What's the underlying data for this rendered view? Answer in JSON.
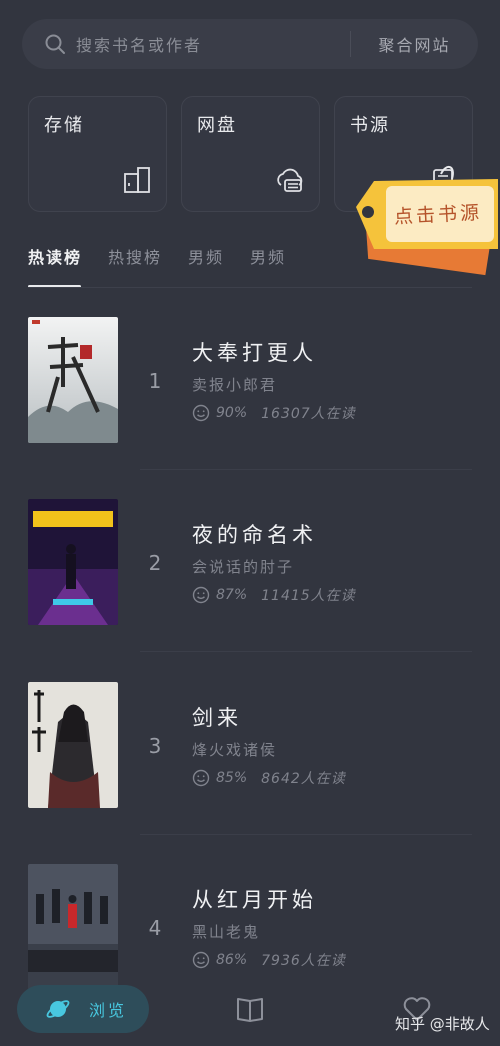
{
  "search": {
    "placeholder": "搜索书名或作者",
    "site_link": "聚合网站"
  },
  "cards": [
    {
      "label": "存储",
      "icon": "storage-icon"
    },
    {
      "label": "网盘",
      "icon": "cloud-drive-icon"
    },
    {
      "label": "书源",
      "icon": "book-source-icon"
    }
  ],
  "tag": {
    "text": "点击书源"
  },
  "tabs": [
    {
      "label": "热读榜",
      "active": true
    },
    {
      "label": "热搜榜",
      "active": false
    },
    {
      "label": "男频",
      "active": false
    },
    {
      "label": "男频",
      "active": false
    }
  ],
  "books": [
    {
      "rank": "1",
      "title": "大奉打更人",
      "author": "卖报小郎君",
      "rating": "90%",
      "readers": "16307人在读"
    },
    {
      "rank": "2",
      "title": "夜的命名术",
      "author": "会说话的肘子",
      "rating": "87%",
      "readers": "11415人在读"
    },
    {
      "rank": "3",
      "title": "剑来",
      "author": "烽火戏诸侯",
      "rating": "85%",
      "readers": "8642人在读"
    },
    {
      "rank": "4",
      "title": "从红月开始",
      "author": "黑山老鬼",
      "rating": "86%",
      "readers": "7936人在读"
    }
  ],
  "nav": {
    "browse_label": "浏览",
    "shelf_icon": "book-open-icon",
    "fav_icon": "heart-icon"
  },
  "watermark": "知乎 @非故人",
  "colors": {
    "background": "#32353f",
    "accent": "#48c7df",
    "tag": "#f5c33b"
  }
}
